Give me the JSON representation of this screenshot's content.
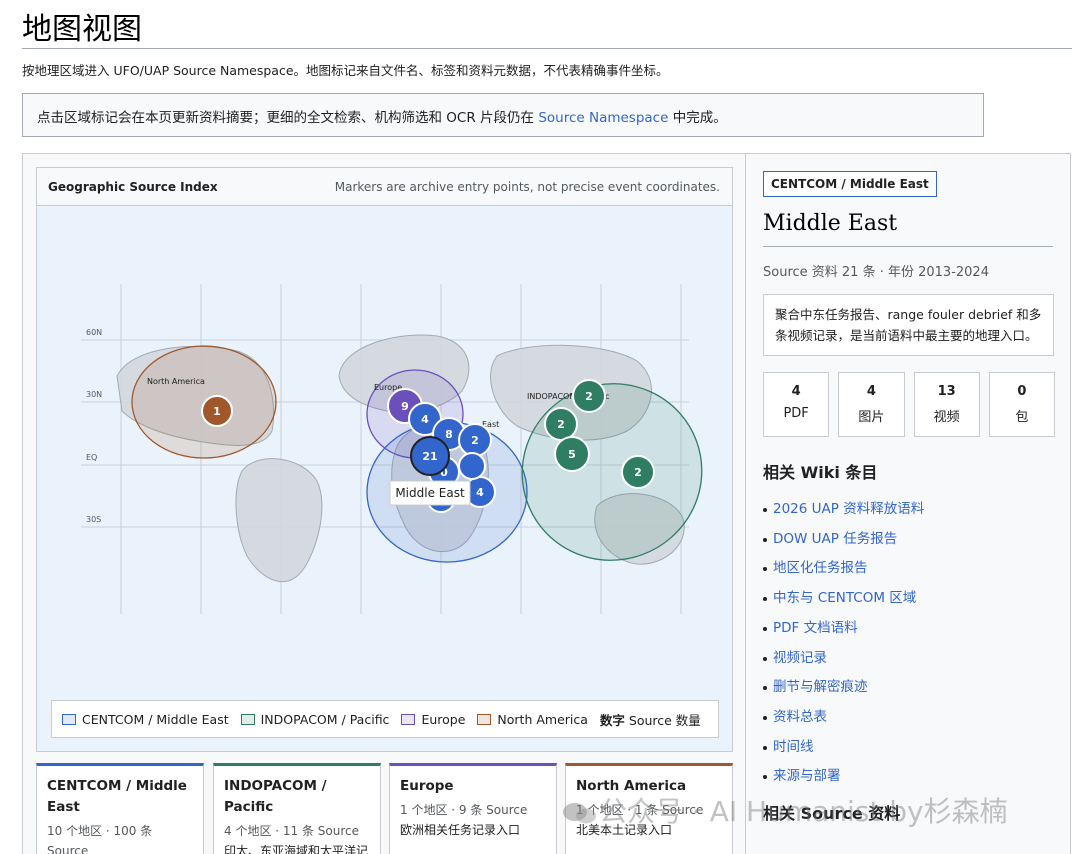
{
  "page": {
    "title": "地图视图",
    "intro": "按地理区域进入 UFO/UAP Source Namespace。地图标记来自文件名、标签和资料元数据，不代表精确事件坐标。",
    "notice_before": "点击区域标记会在本页更新资料摘要；更细的全文检索、机构筛选和 OCR 片段仍在 ",
    "notice_link": "Source Namespace",
    "notice_after": " 中完成。"
  },
  "map": {
    "header_title": "Geographic Source Index",
    "header_note": "Markers are archive entry points, not precise event coordinates.",
    "lat_labels": [
      "60N",
      "30N",
      "EQ",
      "30S"
    ],
    "region_labels": {
      "north_america": "North America",
      "europe": "Europe",
      "indopacom": "INDOPACOM / Pacific",
      "middle_east": "Middle East",
      "east": "East"
    },
    "tooltip": "Middle East",
    "markers": {
      "north_america": [
        "1"
      ],
      "europe": [
        "9"
      ],
      "middle_east": [
        "4",
        "8",
        "2",
        "21",
        "0",
        "4"
      ],
      "indopacom": [
        "2",
        "2",
        "5",
        "2"
      ]
    },
    "colors": {
      "centcom": "#3366cc",
      "indopacom": "#2f7d62",
      "europe": "#6b4fbb",
      "north_america": "#a0582a"
    }
  },
  "legend": {
    "items": [
      "CENTCOM / Middle East",
      "INDOPACOM / Pacific",
      "Europe",
      "North America"
    ],
    "note_strong": "数字",
    "note": " Source 数量"
  },
  "region_cards": [
    {
      "title": "CENTCOM / Middle East",
      "meta": "10 个地区 · 100 条 Source",
      "desc": "",
      "color": "#3366cc"
    },
    {
      "title": "INDOPACOM / Pacific",
      "meta": "4 个地区 · 11 条 Source",
      "desc": "印太、东亚海域和太平洋记录入口",
      "color": "#2f7d62"
    },
    {
      "title": "Europe",
      "meta": "1 个地区 · 9 条 Source",
      "desc": "欧洲相关任务记录入口",
      "color": "#6b4fbb"
    },
    {
      "title": "North America",
      "meta": "1 个地区 · 1 条 Source",
      "desc": "北美本土记录入口",
      "color": "#a0582a"
    }
  ],
  "sidebar": {
    "tag": "CENTCOM / Middle East",
    "title": "Middle East",
    "meta": "Source 资料 21 条 · 年份 2013-2024",
    "desc": "聚合中东任务报告、range fouler debrief 和多条视频记录，是当前语料中最主要的地理入口。",
    "stats": [
      {
        "num": "4",
        "label": "PDF"
      },
      {
        "num": "4",
        "label": "图片"
      },
      {
        "num": "13",
        "label": "视频"
      },
      {
        "num": "0",
        "label": "包"
      }
    ],
    "wiki_title": "相关 Wiki 条目",
    "wiki_links": [
      "2026 UAP 资料释放语料",
      "DOW UAP 任务报告",
      "地区化任务报告",
      "中东与 CENTCOM 区域",
      "PDF 文档语料",
      "视频记录",
      "删节与解密痕迹",
      "资料总表",
      "时间线",
      "来源与部署"
    ],
    "source_title": "相关 Source 资料"
  },
  "watermark": "公众号 · AI Humanist by杉森楠"
}
